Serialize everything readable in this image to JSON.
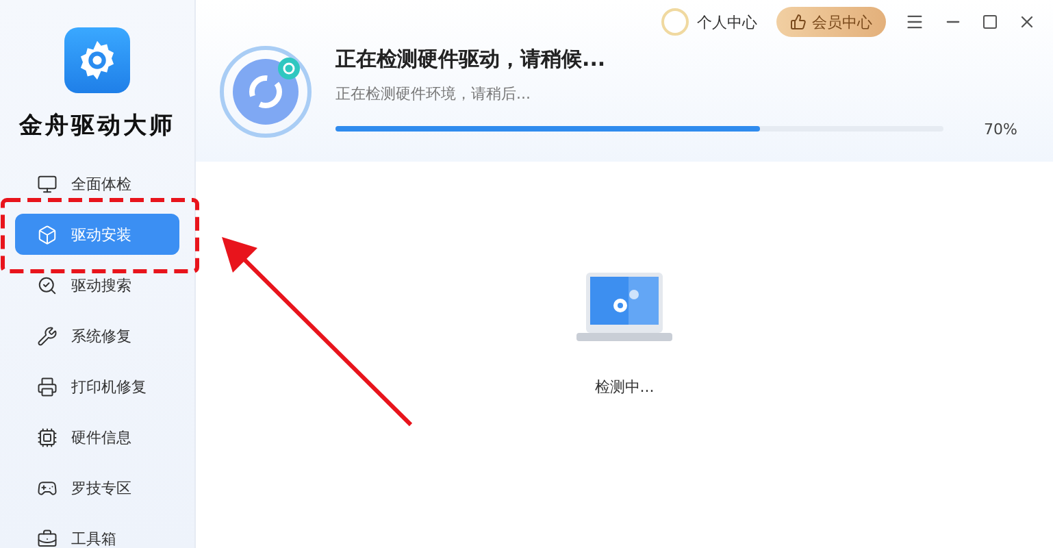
{
  "app": {
    "title": "金舟驱动大师"
  },
  "nav": [
    {
      "label": "全面体检",
      "selected": false
    },
    {
      "label": "驱动安装",
      "selected": true
    },
    {
      "label": "驱动搜索",
      "selected": false
    },
    {
      "label": "系统修复",
      "selected": false
    },
    {
      "label": "打印机修复",
      "selected": false
    },
    {
      "label": "硬件信息",
      "selected": false
    },
    {
      "label": "罗技专区",
      "selected": false
    },
    {
      "label": "工具箱",
      "selected": false
    }
  ],
  "topbar": {
    "user": "个人中心",
    "vip": "会员中心"
  },
  "scan": {
    "title": "正在检测硬件驱动，请稍候...",
    "subtitle": "正在检测硬件环境，请稍后...",
    "level": 0.7,
    "percent": "70%"
  },
  "status": "检测中..."
}
